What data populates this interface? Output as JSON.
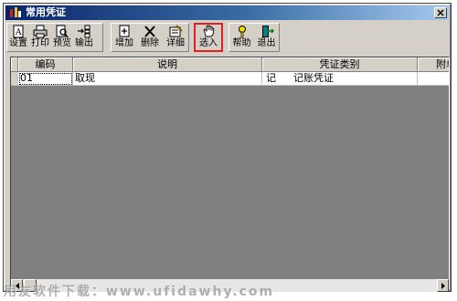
{
  "window": {
    "title": "常用凭证"
  },
  "toolbar": {
    "buttons": [
      {
        "label": "设置",
        "icon": "setup-icon"
      },
      {
        "label": "打印",
        "icon": "printer-icon"
      },
      {
        "label": "预览",
        "icon": "preview-icon"
      },
      {
        "label": "输出",
        "icon": "export-icon"
      },
      {
        "label": "增加",
        "icon": "add-icon"
      },
      {
        "label": "删除",
        "icon": "delete-icon"
      },
      {
        "label": "详细",
        "icon": "detail-icon"
      },
      {
        "label": "选入",
        "icon": "hand-icon"
      },
      {
        "label": "帮助",
        "icon": "help-icon"
      },
      {
        "label": "退出",
        "icon": "exit-icon"
      }
    ],
    "highlight_color": "#e02020"
  },
  "grid": {
    "columns": [
      "编码",
      "说明",
      "凭证类别",
      "附单"
    ],
    "rows": [
      {
        "code": "01",
        "desc": "取现",
        "type_short": "记",
        "type_name": "记账凭证",
        "attach": ""
      }
    ]
  },
  "watermark": "用友软件下载：www.ufidawhy.com"
}
